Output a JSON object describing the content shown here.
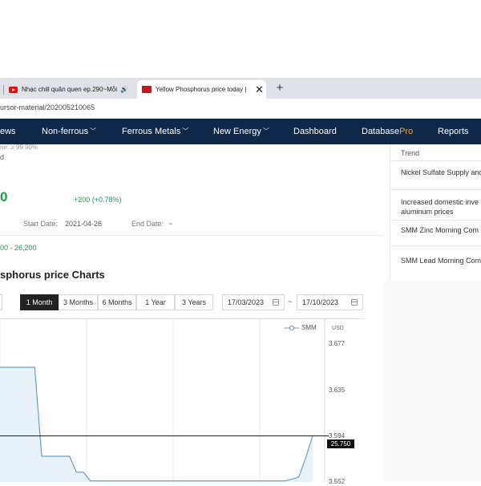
{
  "browser": {
    "tabs": [
      {
        "title": "Nhạc chill quân quen ep.290~Mỗi",
        "active": false
      },
      {
        "title": "Yellow Phosphorus price today |",
        "active": true
      }
    ],
    "url": "ursor-material/202005210065"
  },
  "nav": {
    "items": [
      {
        "label": "ews",
        "dropdown": false
      },
      {
        "label": "Non-ferrous",
        "dropdown": true
      },
      {
        "label": "Ferrous Metals",
        "dropdown": true
      },
      {
        "label": "New Energy",
        "dropdown": true
      },
      {
        "label": "Dashboard",
        "dropdown": false
      },
      {
        "label": "Database",
        "suffix": "Pro",
        "dropdown": false
      },
      {
        "label": "Reports",
        "dropdown": false
      }
    ]
  },
  "product": {
    "purity_partial": "ne: ≥ 99.90%",
    "line2_partial": "d",
    "price_partial": "0",
    "change": "+200 (+0.78%)",
    "start_date_label": "Start Date:",
    "start_date": "2021-04-26",
    "end_date_label": "End Date:",
    "end_date": "~",
    "range_partial": "00 - 26,200"
  },
  "charts": {
    "title_partial": "sphorus price Charts",
    "ranges": [
      "1 Month",
      "3 Months",
      "6 Months",
      "1 Year",
      "3 Years"
    ],
    "active_range": "1 Month",
    "date_from": "17/03/2023",
    "date_sep": "~",
    "date_to": "17/10/2023"
  },
  "sidebar": {
    "heading": "Trend",
    "items": [
      "Nickel Sulfate Supply and",
      "Increased domestic inve",
      "aluminum prices",
      "SMM Zinc Morning Com",
      "SMM Lead Morning Com"
    ]
  },
  "chart_data": {
    "type": "line",
    "legend": "SMM",
    "unit": "USD",
    "y_ticks": [
      "3.677",
      "3.635",
      "3.594",
      "3.552"
    ],
    "current_value_label": "25.750",
    "series": [
      {
        "name": "SMM",
        "points": [
          {
            "x": 0,
            "y": 3.6565
          },
          {
            "x": 1,
            "y": 3.6565
          },
          {
            "x": 2,
            "y": 3.6565
          },
          {
            "x": 3,
            "y": 3.6565
          },
          {
            "x": 4,
            "y": 3.6565
          },
          {
            "x": 5,
            "y": 3.6565
          },
          {
            "x": 6,
            "y": 3.5755
          },
          {
            "x": 7,
            "y": 3.5755
          },
          {
            "x": 8,
            "y": 3.5755
          },
          {
            "x": 9,
            "y": 3.5755
          },
          {
            "x": 10,
            "y": 3.5755
          },
          {
            "x": 11,
            "y": 3.561
          },
          {
            "x": 12,
            "y": 3.561
          },
          {
            "x": 13,
            "y": 3.553
          },
          {
            "x": 14,
            "y": 3.553
          },
          {
            "x": 15,
            "y": 3.553
          },
          {
            "x": 16,
            "y": 3.553
          },
          {
            "x": 17,
            "y": 3.553
          },
          {
            "x": 18,
            "y": 3.553
          },
          {
            "x": 19,
            "y": 3.553
          },
          {
            "x": 20,
            "y": 3.553
          },
          {
            "x": 21,
            "y": 3.553
          },
          {
            "x": 22,
            "y": 3.553
          },
          {
            "x": 23,
            "y": 3.553
          },
          {
            "x": 24,
            "y": 3.553
          },
          {
            "x": 25,
            "y": 3.553
          },
          {
            "x": 26,
            "y": 3.553
          },
          {
            "x": 27,
            "y": 3.553
          },
          {
            "x": 28,
            "y": 3.553
          },
          {
            "x": 29,
            "y": 3.553
          },
          {
            "x": 30,
            "y": 3.553
          },
          {
            "x": 31,
            "y": 3.553
          },
          {
            "x": 32,
            "y": 3.553
          },
          {
            "x": 33,
            "y": 3.553
          },
          {
            "x": 34,
            "y": 3.553
          },
          {
            "x": 35,
            "y": 3.553
          },
          {
            "x": 36,
            "y": 3.553
          },
          {
            "x": 37,
            "y": 3.553
          },
          {
            "x": 38,
            "y": 3.553
          },
          {
            "x": 39,
            "y": 3.553
          },
          {
            "x": 40,
            "y": 3.553
          },
          {
            "x": 41,
            "y": 3.553
          },
          {
            "x": 42,
            "y": 3.5545
          },
          {
            "x": 43,
            "y": 3.5565
          },
          {
            "x": 44,
            "y": 3.574
          },
          {
            "x": 45,
            "y": 3.594
          }
        ]
      }
    ],
    "colors": {
      "line": "#6a9ec4",
      "area": "#e8f1f8",
      "crosshair": "#000000"
    }
  },
  "colors": {
    "nav_bg": "#0f2749",
    "positive": "#1e9c4a",
    "pro": "#f5a623"
  }
}
